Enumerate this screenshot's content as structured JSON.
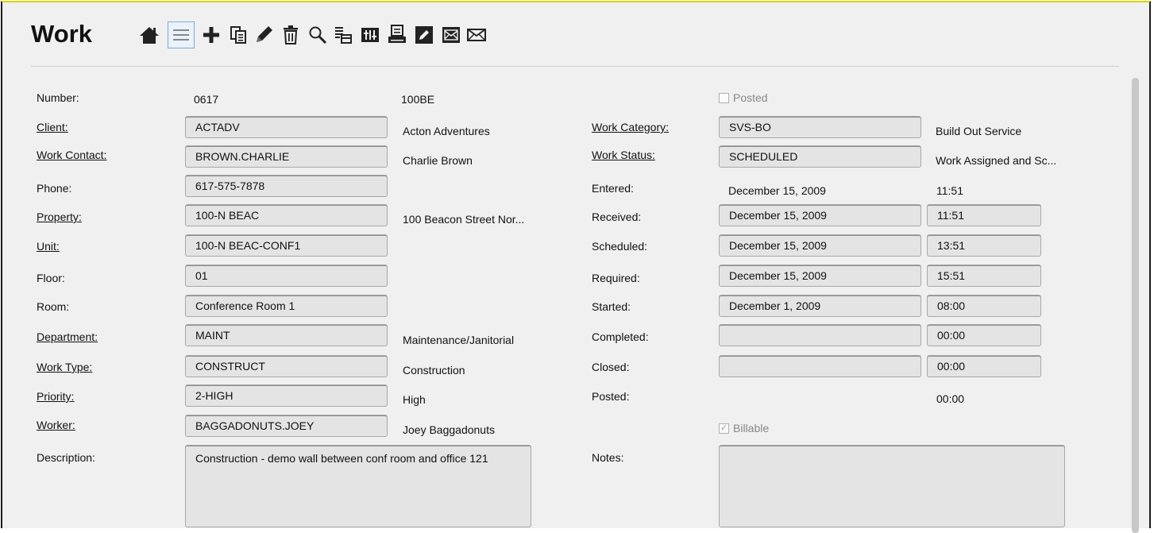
{
  "window": {
    "title": "Work"
  },
  "toolbar": {
    "icons": [
      "home-icon",
      "list-icon",
      "add-icon",
      "copy-icon",
      "edit-icon",
      "delete-icon",
      "search-icon",
      "tree-icon",
      "columns-icon",
      "print-icon",
      "note-icon",
      "email-open-icon",
      "email-icon"
    ],
    "active": "list-icon"
  },
  "labels": {
    "number": "Number:",
    "client": "Client:",
    "work_contact": "Work Contact:",
    "phone": "Phone:",
    "property": "Property:",
    "unit": "Unit:",
    "floor": "Floor:",
    "room": "Room:",
    "department": "Department:",
    "work_type": "Work Type:",
    "priority": "Priority:",
    "worker": "Worker:",
    "description": "Description:",
    "work_category": "Work Category:",
    "work_status": "Work Status:",
    "entered": "Entered:",
    "received": "Received:",
    "scheduled": "Scheduled:",
    "required": "Required:",
    "started": "Started:",
    "completed": "Completed:",
    "closed": "Closed:",
    "posted": "Posted:",
    "notes": "Notes:"
  },
  "values": {
    "number": "0617",
    "number_suffix": "100BE",
    "client": "ACTADV",
    "client_desc": "Acton Adventures",
    "work_contact": "BROWN.CHARLIE",
    "work_contact_desc": "Charlie Brown",
    "phone": "617-575-7878",
    "property": "100-N BEAC",
    "property_desc": "100 Beacon Street Nor...",
    "unit": "100-N BEAC-CONF1",
    "floor": "01",
    "room": "Conference Room 1",
    "department": "MAINT",
    "department_desc": "Maintenance/Janitorial",
    "work_type": "CONSTRUCT",
    "work_type_desc": "Construction",
    "priority": "2-HIGH",
    "priority_desc": "High",
    "worker": "BAGGADONUTS.JOEY",
    "worker_desc": "Joey Baggadonuts",
    "description": "Construction - demo wall between conf room and office 121",
    "work_category": "SVS-BO",
    "work_category_desc": "Build Out Service",
    "work_status": "SCHEDULED",
    "work_status_desc": "Work Assigned and Sc...",
    "entered_date": "December 15, 2009",
    "entered_time": "11:51",
    "received_date": "December 15, 2009",
    "received_time": "11:51",
    "scheduled_date": "December 15, 2009",
    "scheduled_time": "13:51",
    "required_date": "December 15, 2009",
    "required_time": "15:51",
    "started_date": "December 1, 2009",
    "started_time": "08:00",
    "completed_date": "",
    "completed_time": "00:00",
    "closed_date": "",
    "closed_time": "00:00",
    "posted_time": "00:00",
    "notes": ""
  },
  "checkboxes": {
    "posted": {
      "label": "Posted",
      "checked": false
    },
    "billable": {
      "label": "Billable",
      "checked": true
    }
  }
}
